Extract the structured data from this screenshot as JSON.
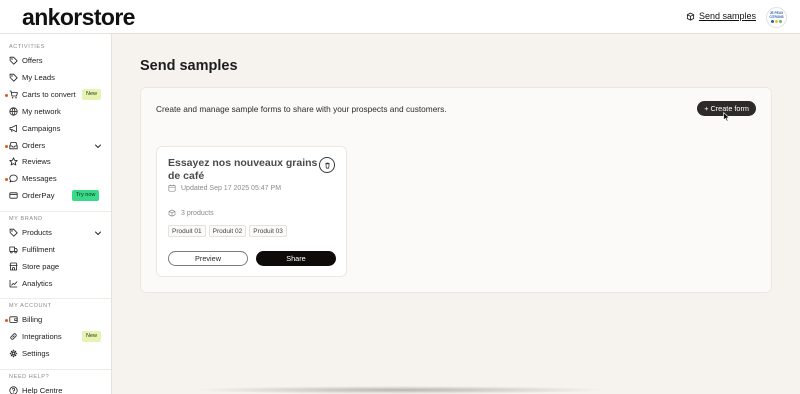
{
  "header": {
    "logo": "ankorstore",
    "send_samples_link": "Send samples",
    "avatar_lines": [
      "JE PEUX",
      "CITRONS"
    ],
    "avatar_dot_colors": [
      "#2b5fb3",
      "#f2c230",
      "#6fb55c"
    ]
  },
  "sidebar": {
    "sections": [
      {
        "title": "ACTIVITIES",
        "items": [
          {
            "label": "Offers",
            "icon": "tag-icon"
          },
          {
            "label": "My Leads",
            "icon": "tag-icon"
          },
          {
            "label": "Carts to convert",
            "icon": "cart-icon",
            "badge": "New",
            "dot": true
          },
          {
            "label": "My network",
            "icon": "globe-icon"
          },
          {
            "label": "Campaigns",
            "icon": "megaphone-icon"
          },
          {
            "label": "Orders",
            "icon": "inbox-icon",
            "dot": true,
            "expandable": true
          },
          {
            "label": "Reviews",
            "icon": "star-icon"
          },
          {
            "label": "Messages",
            "icon": "chat-icon",
            "dot": true
          },
          {
            "label": "OrderPay",
            "icon": "card-icon",
            "badge": "Try now"
          }
        ]
      },
      {
        "title": "MY BRAND",
        "items": [
          {
            "label": "Products",
            "icon": "tag-icon",
            "expandable": true
          },
          {
            "label": "Fulfilment",
            "icon": "truck-icon"
          },
          {
            "label": "Store page",
            "icon": "store-icon"
          },
          {
            "label": "Analytics",
            "icon": "chart-icon"
          }
        ]
      },
      {
        "title": "MY ACCOUNT",
        "items": [
          {
            "label": "Billing",
            "icon": "wallet-icon",
            "dot": true
          },
          {
            "label": "Integrations",
            "icon": "link-icon",
            "badge": "New"
          },
          {
            "label": "Settings",
            "icon": "gear-icon"
          }
        ]
      },
      {
        "title": "NEED HELP?",
        "items": [
          {
            "label": "Help Centre",
            "icon": "help-icon"
          }
        ]
      }
    ]
  },
  "main": {
    "title": "Send samples",
    "description": "Create and manage sample forms to share with your prospects and customers.",
    "create_button": "+ Create form",
    "card": {
      "title": "Essayez nos nouveaux grains de café",
      "updated": "Updated Sep 17 2025 05:47 PM",
      "product_count": "3 products",
      "products": [
        "Produit 01",
        "Produit 02",
        "Produit 03"
      ],
      "preview_button": "Preview",
      "share_button": "Share"
    }
  },
  "colors": {
    "accent_dark": "#2d2a28",
    "share_button": "#0e0a0a",
    "badge_new": "#e6f3b3",
    "badge_try": "#39d98a",
    "notification_dot": "#e05a1a",
    "page_background": "#f6f2ed"
  }
}
